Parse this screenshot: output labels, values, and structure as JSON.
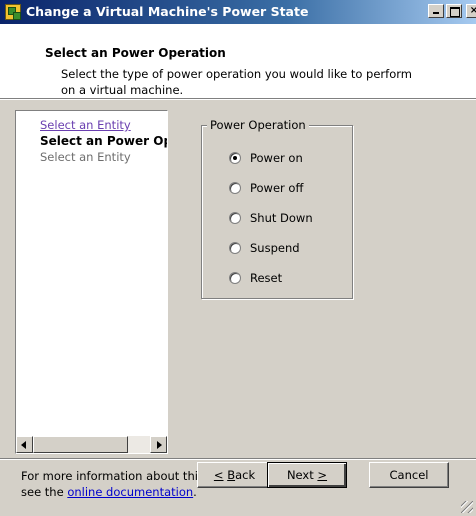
{
  "window": {
    "title": "Change a Virtual Machine's Power State",
    "buttons": {
      "minimize": "_",
      "maximize": "□",
      "close": "×"
    }
  },
  "header": {
    "title": "Select an Power Operation",
    "description": "Select the type of power operation you would like to perform on a virtual machine."
  },
  "steps": [
    {
      "label": "Select an Entity",
      "state": "completed"
    },
    {
      "label": "Select an Power Operation",
      "state": "current"
    },
    {
      "label": "Select an Entity",
      "state": "pending"
    }
  ],
  "power_operation": {
    "legend": "Power Operation",
    "options": [
      "Power on",
      "Power off",
      "Shut Down",
      "Suspend",
      "Reset"
    ],
    "selected": "Power on"
  },
  "footer": {
    "help_prefix": "For more information about this wizard,",
    "help_line2_prefix": "see the ",
    "help_link": "online documentation",
    "help_suffix": ".",
    "back_label": "Back",
    "back_accel": "<",
    "back_mnemonic": "B",
    "next_label": "Next",
    "next_accel": ">",
    "next_mnemonic": ">",
    "cancel_label": "Cancel"
  },
  "icons": {
    "app": "wizard-app-icon",
    "scroll_left": "arrow-left-icon",
    "scroll_right": "arrow-right-icon",
    "resize": "resize-grip-icon"
  }
}
